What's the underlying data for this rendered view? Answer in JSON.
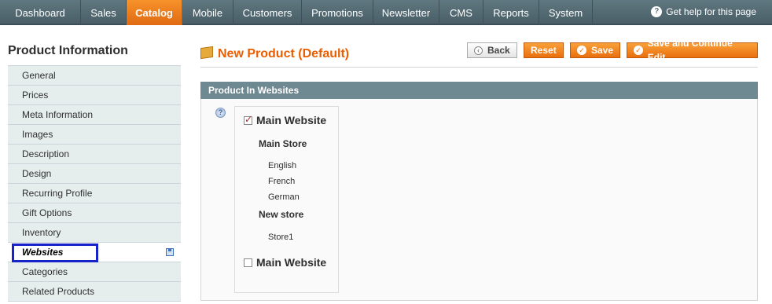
{
  "nav": {
    "items": [
      {
        "label": "Dashboard"
      },
      {
        "label": "Sales"
      },
      {
        "label": "Catalog"
      },
      {
        "label": "Mobile"
      },
      {
        "label": "Customers"
      },
      {
        "label": "Promotions"
      },
      {
        "label": "Newsletter"
      },
      {
        "label": "CMS"
      },
      {
        "label": "Reports"
      },
      {
        "label": "System"
      }
    ],
    "active": "Catalog",
    "help_label": "Get help for this page"
  },
  "sidebar": {
    "title": "Product Information",
    "items": [
      {
        "label": "General"
      },
      {
        "label": "Prices"
      },
      {
        "label": "Meta Information"
      },
      {
        "label": "Images"
      },
      {
        "label": "Description"
      },
      {
        "label": "Design"
      },
      {
        "label": "Recurring Profile"
      },
      {
        "label": "Gift Options"
      },
      {
        "label": "Inventory"
      },
      {
        "label": "Websites"
      },
      {
        "label": "Categories"
      },
      {
        "label": "Related Products"
      }
    ],
    "active": "Websites"
  },
  "header": {
    "title": "New Product (Default)",
    "buttons": {
      "back": "Back",
      "reset": "Reset",
      "save": "Save",
      "save_continue": "Save and Continue Edit"
    }
  },
  "websites_section": {
    "title": "Product In Websites",
    "websites": [
      {
        "name": "Main Website",
        "checked": true,
        "store": "Main Store",
        "views": [
          "English",
          "French",
          "German"
        ]
      },
      {
        "store": "New store",
        "views": [
          "Store1"
        ]
      },
      {
        "name": "Main Website",
        "checked": false
      }
    ]
  },
  "colors": {
    "accent": "#eb5e00",
    "nav_bg": "#5a7179",
    "section_head": "#6f8992",
    "active_outline": "#1523c8"
  }
}
